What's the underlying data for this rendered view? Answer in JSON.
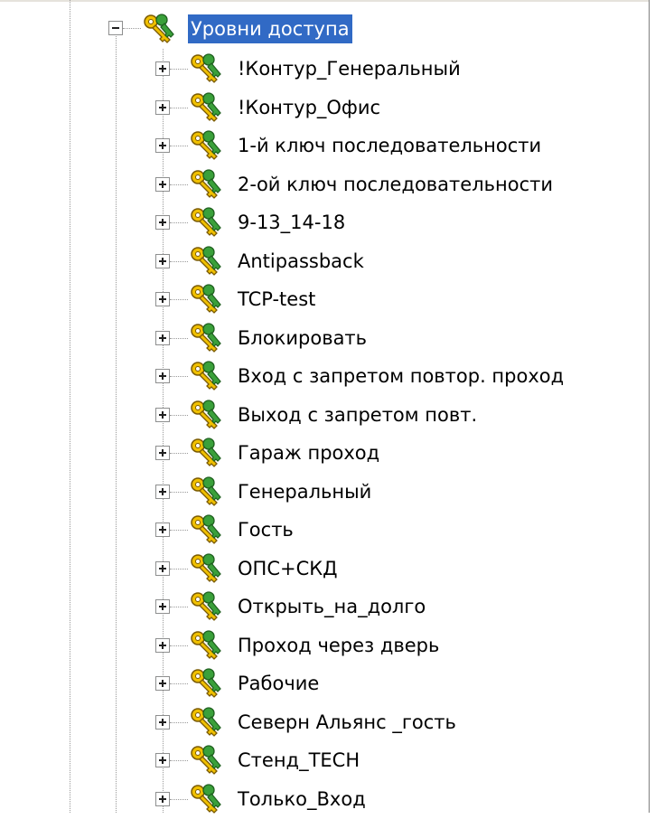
{
  "tree": {
    "root": {
      "label": "Уровни доступа",
      "icon": "keys-icon",
      "expanded": true,
      "selected": true
    },
    "children": [
      {
        "label": "!Контур_Генеральный"
      },
      {
        "label": "!Контур_Офис"
      },
      {
        "label": "1-й ключ последовательности"
      },
      {
        "label": "2-ой ключ последовательности"
      },
      {
        "label": "9-13_14-18"
      },
      {
        "label": "Antipassback"
      },
      {
        "label": "TCP-test"
      },
      {
        "label": "Блокировать"
      },
      {
        "label": "Вход с запретом повтор. проход"
      },
      {
        "label": "Выход с запретом повт."
      },
      {
        "label": "Гараж проход"
      },
      {
        "label": "Генеральный"
      },
      {
        "label": "Гость"
      },
      {
        "label": "ОПС+СКД"
      },
      {
        "label": "Открыть_на_долго"
      },
      {
        "label": "Проход через дверь"
      },
      {
        "label": "Рабочие"
      },
      {
        "label": "Северн Альянс _гость"
      },
      {
        "label": "Стенд_TECH"
      },
      {
        "label": "Только_Вход"
      }
    ]
  },
  "colors": {
    "selection": "#316ac5",
    "key_gold": "#f0c000",
    "key_green": "#2f8f2f"
  }
}
